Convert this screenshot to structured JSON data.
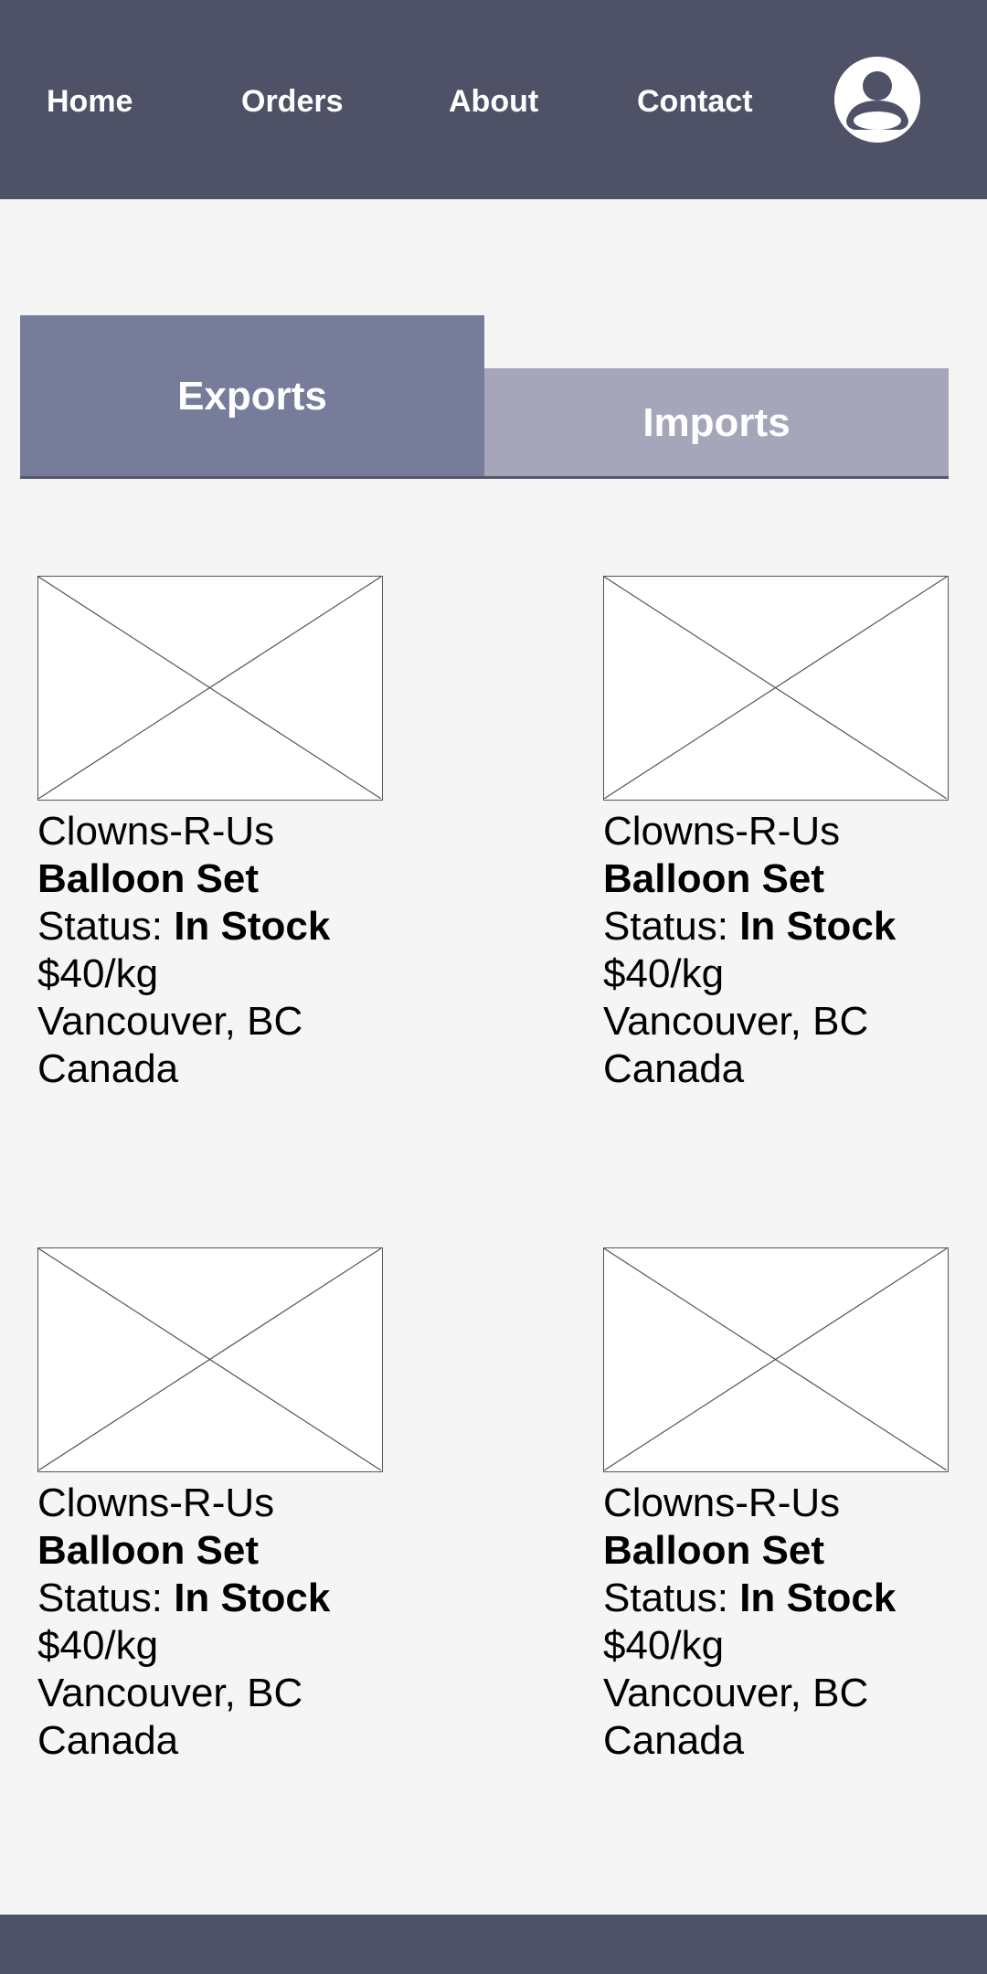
{
  "nav": {
    "home": "Home",
    "orders": "Orders",
    "about": "About",
    "contact": "Contact",
    "avatar_icon": "user-avatar-icon"
  },
  "tabs": {
    "exports": "Exports",
    "imports": "Imports",
    "active": "Exports"
  },
  "colors": {
    "header_bg": "#4f5166",
    "tab_active_bg": "#787c9b",
    "tab_inactive_bg": "#a5a6b9",
    "page_bg": "#f5f5f5"
  },
  "products": [
    {
      "company": "Clowns-R-Us",
      "name": "Balloon Set",
      "status_label": "Status: ",
      "status_value": "In Stock",
      "price": "$40/kg",
      "city": "Vancouver, BC",
      "country": "Canada",
      "image_icon": "image-placeholder-icon"
    },
    {
      "company": "Clowns-R-Us",
      "name": "Balloon Set",
      "status_label": "Status: ",
      "status_value": "In Stock",
      "price": "$40/kg",
      "city": "Vancouver, BC",
      "country": "Canada",
      "image_icon": "image-placeholder-icon"
    },
    {
      "company": "Clowns-R-Us",
      "name": "Balloon Set",
      "status_label": "Status: ",
      "status_value": "In Stock",
      "price": "$40/kg",
      "city": "Vancouver, BC",
      "country": "Canada",
      "image_icon": "image-placeholder-icon"
    },
    {
      "company": "Clowns-R-Us",
      "name": "Balloon Set",
      "status_label": "Status: ",
      "status_value": "In Stock",
      "price": "$40/kg",
      "city": "Vancouver, BC",
      "country": "Canada",
      "image_icon": "image-placeholder-icon"
    }
  ]
}
